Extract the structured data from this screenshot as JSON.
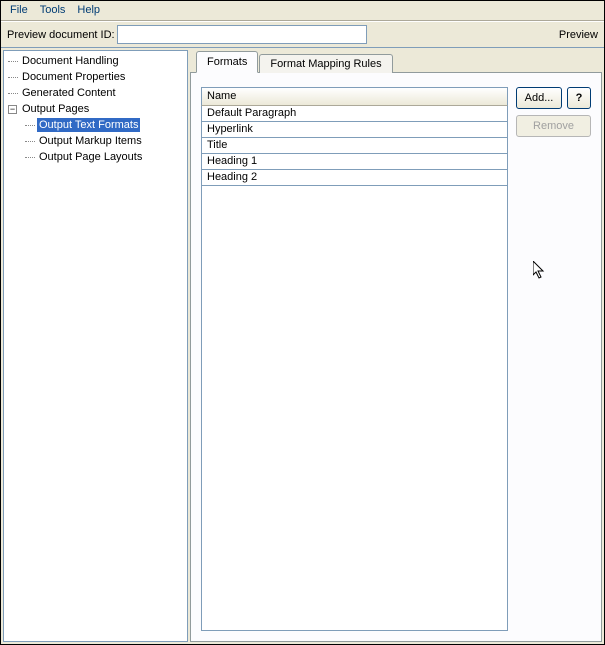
{
  "menubar": {
    "file": "File",
    "tools": "Tools",
    "help": "Help"
  },
  "preview": {
    "label": "Preview document ID:",
    "value": "",
    "link": "Preview"
  },
  "tree": {
    "items": [
      "Document Handling",
      "Document Properties",
      "Generated Content"
    ],
    "output_pages": {
      "label": "Output Pages",
      "children": [
        "Output Text Formats",
        "Output Markup Items",
        "Output Page Layouts"
      ]
    }
  },
  "tabs": {
    "formats": "Formats",
    "mapping": "Format Mapping Rules"
  },
  "table": {
    "header": "Name",
    "rows": [
      "Default Paragraph",
      "Hyperlink",
      "Title",
      "Heading 1",
      "Heading 2"
    ]
  },
  "buttons": {
    "add": "Add...",
    "remove": "Remove",
    "help": "?"
  }
}
